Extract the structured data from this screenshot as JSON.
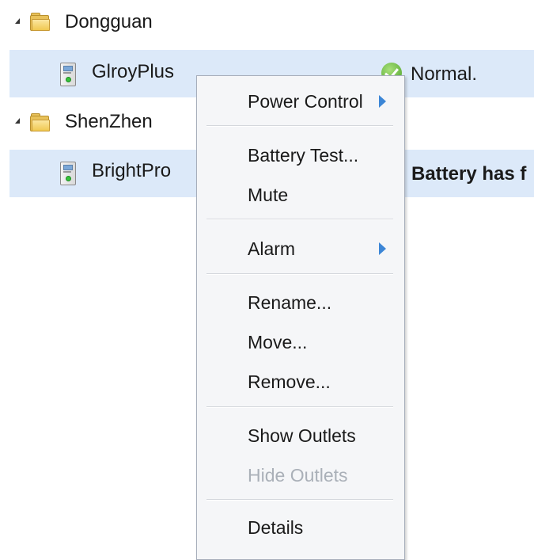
{
  "tree": {
    "nodes": [
      {
        "type": "folder",
        "label": "Dongguan"
      },
      {
        "type": "device",
        "label": "GlroyPlus",
        "status": "Normal.",
        "status_icon": "green-check-icon",
        "selected": true
      },
      {
        "type": "folder",
        "label": "ShenZhen"
      },
      {
        "type": "device",
        "label": "BrightPro",
        "status": "Battery has f",
        "selected": true
      }
    ]
  },
  "context_menu": {
    "items": [
      {
        "label": "Power Control",
        "submenu": true
      },
      {
        "label": "Battery Test..."
      },
      {
        "label": "Mute"
      },
      {
        "label": "Alarm",
        "submenu": true
      },
      {
        "label": "Rename..."
      },
      {
        "label": "Move..."
      },
      {
        "label": "Remove..."
      },
      {
        "label": "Show Outlets"
      },
      {
        "label": "Hide Outlets",
        "disabled": true
      },
      {
        "label": "Details"
      }
    ]
  },
  "colors": {
    "selection": "#dce9f9",
    "submenu_arrow": "#3c86d6",
    "disabled_text": "#aab0b8",
    "status_ok": "#4ca22a"
  }
}
